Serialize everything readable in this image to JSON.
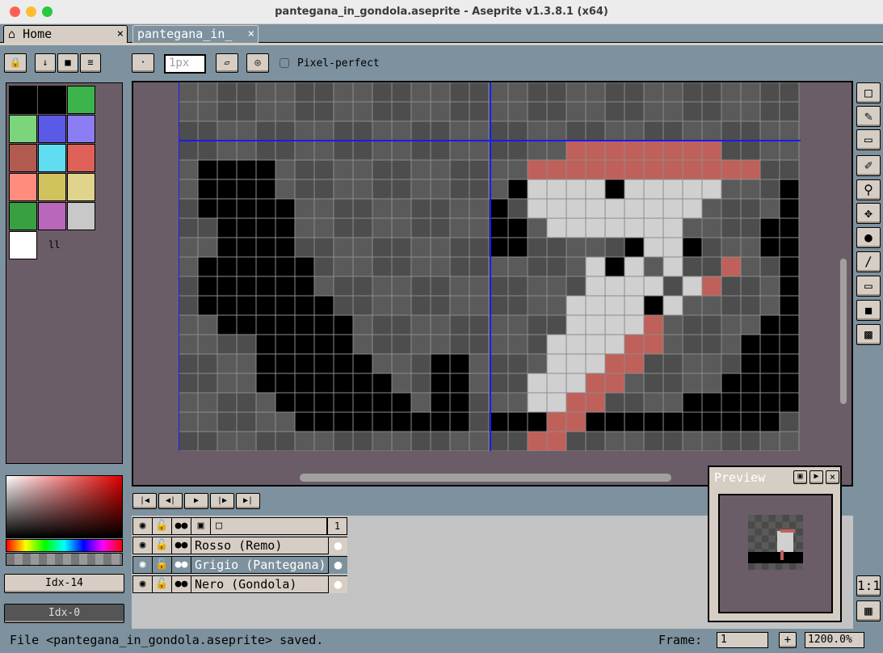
{
  "window": {
    "title": "pantegana_in_gondola.aseprite - Aseprite v1.3.8.1 (x64)"
  },
  "tabs": [
    {
      "label": "Home",
      "close": "×"
    },
    {
      "label": "pantegana_in_",
      "close": "×"
    }
  ],
  "toolbar": {
    "brush_size_value": "1px",
    "pixel_perfect_label": "Pixel-perfect"
  },
  "palette": {
    "colors": [
      "#000000",
      "#000000",
      "#3cb44b",
      "#7bd67b",
      "#5a5ae6",
      "#8b7df2",
      "#b35a50",
      "#5fdcef",
      "#e06158",
      "#ff8c7d",
      "#d0c35d",
      "#e0d48c",
      "#38a041",
      "#b967bb",
      "#c8c8c8",
      "#ffffff"
    ],
    "more_label": "ll"
  },
  "sprite": {
    "grid_cols": 32,
    "grid_rows": 19,
    "palette": {
      "0": "#000000",
      "1": "#4d4d4d",
      "2": "#666666",
      "3": "#d0d0d0",
      "4": "#c0605a",
      "5": "#424242"
    }
  },
  "color_bar": {
    "fg_label": "Idx-14",
    "bg_label": "Idx-0"
  },
  "timeline": {
    "frame_number": "1",
    "layers": [
      {
        "name": "Rosso (Remo)"
      },
      {
        "name": "Grigio (Pantegana)"
      },
      {
        "name": "Nero (Gondola)"
      }
    ]
  },
  "preview": {
    "title": "Preview"
  },
  "zoom_buttons": {
    "one_to_one": "1:1"
  },
  "status": {
    "message": "File <pantegana_in_gondola.aseprite> saved.",
    "frame_label": "Frame:",
    "frame_value": "1",
    "plus": "+",
    "zoom": "1200.0%"
  }
}
